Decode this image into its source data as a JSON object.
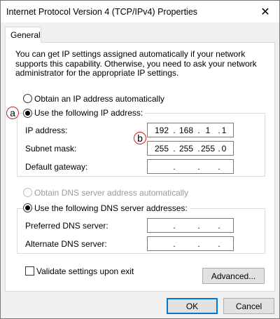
{
  "window": {
    "title": "Internet Protocol Version 4 (TCP/IPv4) Properties",
    "close_glyph": "✕"
  },
  "tabs": [
    {
      "label": "General"
    }
  ],
  "intro": "You can get IP settings assigned automatically if your network supports this capability. Otherwise, you need to ask your network administrator for the appropriate IP settings.",
  "ip_section": {
    "auto_label": "Obtain an IP address automatically",
    "auto_checked": false,
    "manual_label": "Use the following IP address:",
    "manual_checked": true,
    "fields": [
      {
        "label": "IP address:",
        "octets": [
          "192",
          "168",
          "1",
          "1"
        ]
      },
      {
        "label": "Subnet mask:",
        "octets": [
          "255",
          "255",
          "255",
          "0"
        ]
      },
      {
        "label": "Default gateway:",
        "octets": [
          "",
          "",
          "",
          ""
        ]
      }
    ]
  },
  "dns_section": {
    "auto_label": "Obtain DNS server address automatically",
    "auto_disabled": true,
    "manual_label": "Use the following DNS server addresses:",
    "manual_checked": true,
    "fields": [
      {
        "label": "Preferred DNS server:",
        "octets": [
          "",
          "",
          "",
          ""
        ]
      },
      {
        "label": "Alternate DNS server:",
        "octets": [
          "",
          "",
          "",
          ""
        ]
      }
    ]
  },
  "validate": {
    "label": "Validate settings upon exit",
    "checked": false
  },
  "buttons": {
    "advanced": "Advanced...",
    "ok": "OK",
    "cancel": "Cancel"
  },
  "annotations": {
    "a": "a",
    "b": "b"
  },
  "colors": {
    "marker_border": "#d32020",
    "default_button_border": "#0078d7"
  }
}
